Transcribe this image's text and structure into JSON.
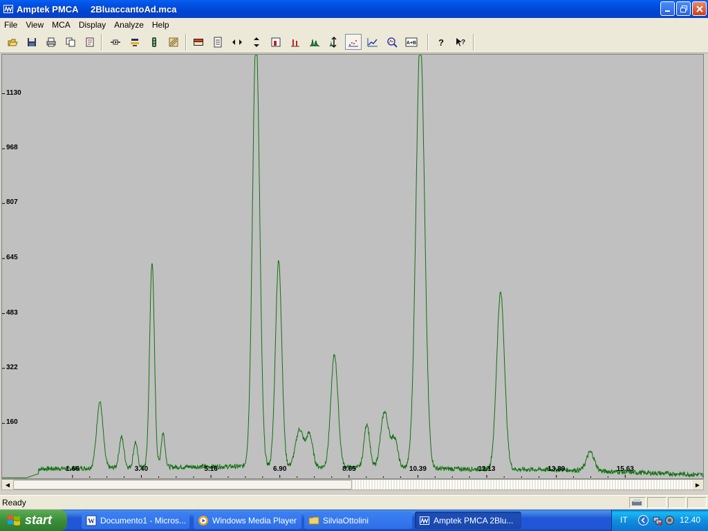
{
  "window": {
    "app_name": "Amptek PMCA",
    "file_name": "2BluaccantoAd.mca"
  },
  "menu": [
    "File",
    "View",
    "MCA",
    "Display",
    "Analyze",
    "Help"
  ],
  "toolbar": {
    "buttons": [
      {
        "name": "open-icon",
        "group": 0
      },
      {
        "name": "save-icon",
        "group": 0
      },
      {
        "name": "print-icon",
        "group": 0
      },
      {
        "name": "copy-icon",
        "group": 0
      },
      {
        "name": "properties-icon",
        "group": 0
      },
      {
        "name": "connect-icon",
        "group": 1
      },
      {
        "name": "acquire-icon",
        "group": 1
      },
      {
        "name": "traffic-light-icon",
        "group": 1
      },
      {
        "name": "clear-icon",
        "group": 1
      },
      {
        "name": "spectrum-color-icon",
        "group": 2
      },
      {
        "name": "document-icon",
        "group": 2
      },
      {
        "name": "horizontal-zoom-icon",
        "group": 2
      },
      {
        "name": "vertical-zoom-icon",
        "group": 2
      },
      {
        "name": "roi-icon",
        "group": 2
      },
      {
        "name": "bar-chart-icon",
        "group": 2
      },
      {
        "name": "peaks-icon",
        "group": 2
      },
      {
        "name": "autoscale-icon",
        "group": 2
      },
      {
        "name": "points-icon",
        "group": 2,
        "active": true
      },
      {
        "name": "line-plot-icon",
        "group": 2
      },
      {
        "name": "magnify-icon",
        "group": 2
      },
      {
        "name": "a-plus-b-icon",
        "group": 2,
        "label": "A+B"
      },
      {
        "name": "help-icon",
        "group": 3
      },
      {
        "name": "context-help-icon",
        "group": 3
      }
    ]
  },
  "chart_data": {
    "type": "line",
    "line_color": "#107010",
    "background": "#c0c0c0",
    "y_tick_labels": [
      "1130",
      "968",
      "807",
      "645",
      "483",
      "322",
      "160"
    ],
    "y_tick_values": [
      1130,
      968,
      807,
      645,
      483,
      322,
      160
    ],
    "x_tick_labels": [
      "1.66",
      "3.40",
      "5.16",
      "6.90",
      "8.65",
      "10.39",
      "12.13",
      "13.89",
      "15.63"
    ],
    "x_tick_values": [
      1.66,
      3.4,
      5.16,
      6.9,
      8.65,
      10.39,
      12.13,
      13.89,
      15.63
    ],
    "xlim": [
      -0.12,
      17.6
    ],
    "ylim": [
      0,
      1245
    ],
    "baseline": 15,
    "peaks": [
      {
        "x": 2.35,
        "height": 195,
        "width": 0.08
      },
      {
        "x": 2.9,
        "height": 90,
        "width": 0.06
      },
      {
        "x": 3.25,
        "height": 75,
        "width": 0.05
      },
      {
        "x": 3.67,
        "height": 605,
        "width": 0.06
      },
      {
        "x": 3.95,
        "height": 100,
        "width": 0.05
      },
      {
        "x": 6.3,
        "height": 1275,
        "width": 0.09
      },
      {
        "x": 6.87,
        "height": 605,
        "width": 0.08
      },
      {
        "x": 7.4,
        "height": 110,
        "width": 0.1
      },
      {
        "x": 7.65,
        "height": 95,
        "width": 0.08
      },
      {
        "x": 8.28,
        "height": 330,
        "width": 0.09
      },
      {
        "x": 9.1,
        "height": 130,
        "width": 0.07
      },
      {
        "x": 9.55,
        "height": 165,
        "width": 0.1
      },
      {
        "x": 9.8,
        "height": 85,
        "width": 0.08
      },
      {
        "x": 10.45,
        "height": 1270,
        "width": 0.11
      },
      {
        "x": 12.48,
        "height": 520,
        "width": 0.1
      },
      {
        "x": 14.75,
        "height": 55,
        "width": 0.1
      }
    ]
  },
  "status": {
    "text": "Ready"
  },
  "taskbar": {
    "start_label": "start",
    "items": [
      {
        "name": "taskbar-word",
        "label": "Documento1 - Micros...",
        "icon": "word-icon"
      },
      {
        "name": "taskbar-media-player",
        "label": "Windows Media Player",
        "icon": "media-player-icon"
      },
      {
        "name": "taskbar-folder",
        "label": "SilviaOttolini",
        "icon": "folder-icon"
      },
      {
        "name": "taskbar-pmca",
        "label": "Amptek PMCA     2Blu...",
        "icon": "pmca-icon",
        "active": true
      }
    ],
    "language": "IT",
    "clock": "12.40"
  }
}
